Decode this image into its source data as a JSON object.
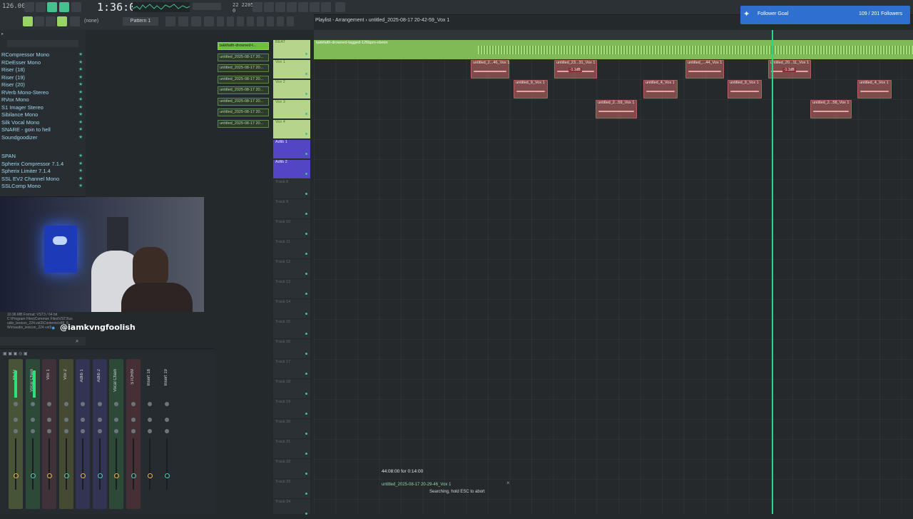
{
  "toolbar": {
    "tempo": "126.00",
    "time": "1:36:05",
    "cpu_top": "22  2205 MB",
    "cpu_bottom": "0",
    "pattern": "Pattern 1",
    "snap": "(none)",
    "breadcrumb": "Playlist - Arrangement › untitled_2025-08-17 20-42-59_Vox 1"
  },
  "browser": {
    "plugins": [
      "RCompressor Mono",
      "RDeEsser Mono",
      "Riser (18)",
      "Riser (19)",
      "Riser (20)",
      "RVerb Mono-Stereo",
      "RVox Mono",
      "S1 Imager Stereo",
      "Sibilance Mono",
      "Silk Vocal Mono",
      "SNARE - goin to hell",
      "Soundgoodizer",
      "SPAN",
      "Spherix Compressor 7.1.4",
      "Spherix Limiter 7.1.4",
      "SSL EV2 Channel Mono",
      "SSLComp Mono"
    ]
  },
  "plugin_info": {
    "line1": "10.96 MB  Format: VST3 / 64 bit",
    "line2": "C:\\Program Files\\Common Files\\VST3\\so",
    "line3": "udio_lexicon_224.vst3\\Contents\\x86_6",
    "line4": "Win\\audio_lexicon_224.vst3"
  },
  "stream": {
    "handle": "@iamkvngfoolish",
    "goal_label": "Follower Goal",
    "goal_count": "109 / 201 Followers"
  },
  "patterns": [
    "takkfaith-drowned-t...",
    "untitled_2025-08-17 20...",
    "untitled_2025-08-17 20...",
    "untitled_2025-08-17 20...",
    "untitled_2025-08-17 20...",
    "untitled_2025-08-17 20...",
    "untitled_2025-08-17 20...",
    "untitled_2025-08-17 20..."
  ],
  "tracks": [
    {
      "name": "BEAT",
      "color": "green"
    },
    {
      "name": "Vox 1",
      "color": "green"
    },
    {
      "name": "Vox 2",
      "color": "green"
    },
    {
      "name": "Vox 3",
      "color": "green"
    },
    {
      "name": "Vox 4",
      "color": "green"
    },
    {
      "name": "Adlib 1",
      "color": "purple"
    },
    {
      "name": "Adlib 2",
      "color": "purple"
    },
    {
      "name": "Track 8",
      "color": ""
    },
    {
      "name": "Track 9",
      "color": ""
    },
    {
      "name": "Track 10",
      "color": ""
    },
    {
      "name": "Track 11",
      "color": ""
    },
    {
      "name": "Track 12",
      "color": ""
    },
    {
      "name": "Track 13",
      "color": ""
    },
    {
      "name": "Track 14",
      "color": ""
    },
    {
      "name": "Track 15",
      "color": ""
    },
    {
      "name": "Track 16",
      "color": ""
    },
    {
      "name": "Track 17",
      "color": ""
    },
    {
      "name": "Track 18",
      "color": ""
    },
    {
      "name": "Track 19",
      "color": ""
    },
    {
      "name": "Track 20",
      "color": ""
    },
    {
      "name": "Track 21",
      "color": ""
    },
    {
      "name": "Track 22",
      "color": ""
    },
    {
      "name": "Track 23",
      "color": ""
    },
    {
      "name": "Track 24",
      "color": ""
    }
  ],
  "beat_clip": "takkfaith-drowned-tagged-126bpm-ebmin",
  "clips": [
    {
      "label": "untitled_2...46_Vox 1",
      "tag": ""
    },
    {
      "label": "untitled_23...31_Vox 1",
      "tag": "-1.1dB"
    },
    {
      "label": "untitled_...44_Vox 1",
      "tag": ""
    },
    {
      "label": "untitled_20...11_Vox 1",
      "tag": "-1.1dB"
    },
    {
      "label": "untitled_9_Vox 1",
      "tag": ""
    },
    {
      "label": "untitled_4_Vox 1",
      "tag": ""
    },
    {
      "label": "untitled_9_Vox 1",
      "tag": ""
    },
    {
      "label": "untitled_4_Vox 1",
      "tag": ""
    },
    {
      "label": "untitled_2...59_Vox 1",
      "tag": ""
    },
    {
      "label": "untitled_2...58_Vox 1",
      "tag": ""
    }
  ],
  "mixer": {
    "strips": [
      {
        "label": "BEAT",
        "color": "#8ea84a"
      },
      {
        "label": "Vocal Chain",
        "color": "#3c8a4c"
      },
      {
        "label": "Vox 1",
        "color": "#7a3f52"
      },
      {
        "label": "Vox 2",
        "color": "#8c8a3c"
      },
      {
        "label": "Adlib 1",
        "color": "#4a4aa0"
      },
      {
        "label": "Adlib 2",
        "color": "#4a4aa0"
      },
      {
        "label": "Vocal Chain",
        "color": "#3c8a4c"
      },
      {
        "label": "STORM",
        "color": "#8a3c45"
      },
      {
        "label": "Insert 18",
        "color": ""
      },
      {
        "label": "Insert 19",
        "color": ""
      }
    ]
  },
  "status": {
    "time_range": "44:08:00 for 0:14:00",
    "file": "untitled_2025-08-17 20-29-46_Vox 1",
    "message": "Searching, hold ESC to abort"
  },
  "colors": {
    "accent": "#46c08f",
    "playhead": "#2dd58b",
    "clip": "#c96868",
    "beat": "#7fba57",
    "goal": "#2f6fd0"
  }
}
